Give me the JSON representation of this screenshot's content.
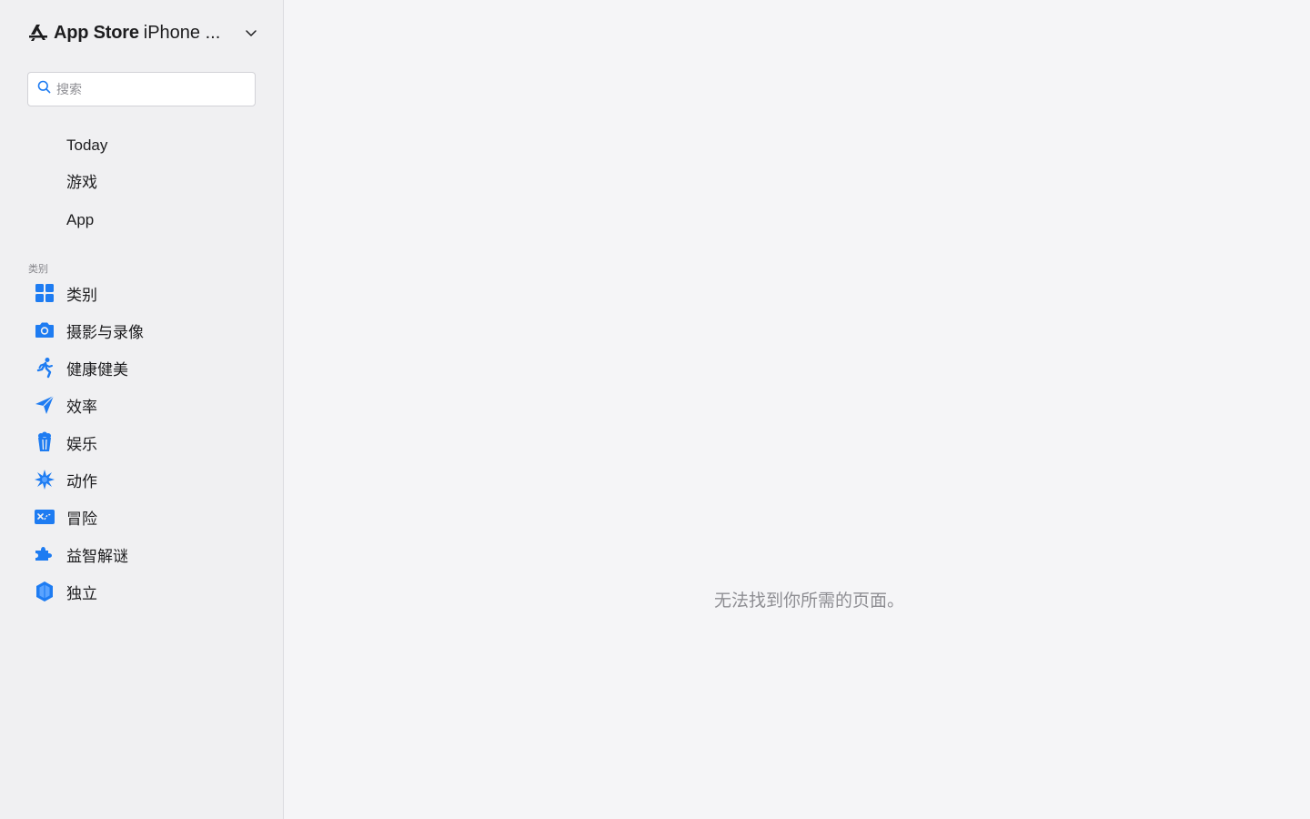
{
  "header": {
    "brand": "App Store",
    "platform": "iPhone ...",
    "logo_icon": "app-store-icon",
    "dropdown_icon": "chevron-down-icon"
  },
  "search": {
    "placeholder": "搜索",
    "value": ""
  },
  "nav": {
    "items": [
      {
        "label": "Today"
      },
      {
        "label": "游戏"
      },
      {
        "label": "App"
      }
    ]
  },
  "categories": {
    "section_label": "类别",
    "items": [
      {
        "label": "类别",
        "icon": "grid-icon"
      },
      {
        "label": "摄影与录像",
        "icon": "camera-icon"
      },
      {
        "label": "健康健美",
        "icon": "runner-icon"
      },
      {
        "label": "效率",
        "icon": "paper-plane-icon"
      },
      {
        "label": "娱乐",
        "icon": "popcorn-icon"
      },
      {
        "label": "动作",
        "icon": "burst-icon"
      },
      {
        "label": "冒险",
        "icon": "map-icon"
      },
      {
        "label": "益智解谜",
        "icon": "puzzle-icon"
      },
      {
        "label": "独立",
        "icon": "cube-icon"
      }
    ]
  },
  "main": {
    "message": "无法找到你所需的页面。"
  },
  "colors": {
    "accent": "#1e7cf2",
    "sidebar_bg": "#f0f0f2",
    "main_bg": "#f5f5f7"
  }
}
